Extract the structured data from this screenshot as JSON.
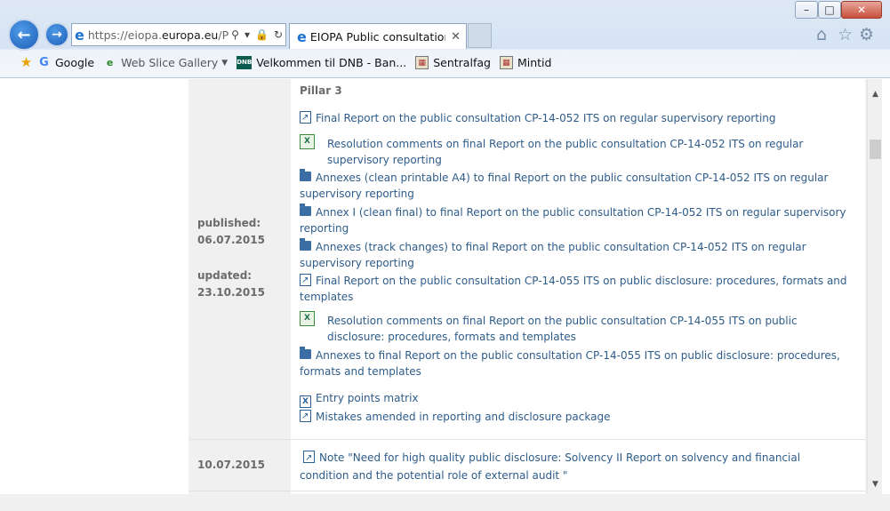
{
  "browser": {
    "address": {
      "domain_prefix": "https://eiopa.",
      "domain": "europa.eu",
      "path": "/Pag"
    },
    "tab": {
      "title": "EIOPA Public consultation ..."
    },
    "favorites": [
      {
        "label": "Google"
      },
      {
        "label": "Web Slice Gallery"
      },
      {
        "label": "Velkommen til DNB - Ban..."
      },
      {
        "label": "Sentralfag"
      },
      {
        "label": "Mintid"
      }
    ],
    "window": {
      "minimize": "–",
      "maximize": "□",
      "close": "✕"
    }
  },
  "page": {
    "section_title": "Pillar 3",
    "published_label": "published:",
    "published_date": "06.07.2015",
    "updated_label": "updated:",
    "updated_date": "23.10.2015",
    "documents": [
      {
        "type": "pdf",
        "text": "Final Report on the public consultation CP-14-052 ITS on regular supervisory reporting"
      },
      {
        "type": "xls",
        "text": "Resolution comments on final Report on the public consultation CP-14-052 ITS on regular supervisory reporting"
      },
      {
        "type": "folder",
        "text": "Annexes (clean printable A4) to final Report on the public consultation CP-14-052 ITS on regular supervisory reporting"
      },
      {
        "type": "folder",
        "text": "Annex I (clean final) to final Report on the public consultation CP-14-052 ITS on regular supervisory reporting"
      },
      {
        "type": "folder",
        "text": "Annexes (track changes) to final Report on the public consultation CP-14-052 ITS on regular supervisory reporting"
      },
      {
        "type": "pdf",
        "text": "Final Report on the public consultation CP-14-055 ITS on public disclosure: procedures, formats and templates"
      },
      {
        "type": "xls",
        "text": "Resolution comments on final Report on the public consultation CP-14-055 ITS on public disclosure: procedures, formats and templates"
      },
      {
        "type": "folder",
        "text": "Annexes to final Report on the public consultation CP-14-055 ITS on public disclosure: procedures, formats and templates"
      },
      {
        "type": "x",
        "text": "Entry points matrix"
      },
      {
        "type": "pdf",
        "text": "Mistakes amended in reporting and disclosure package"
      }
    ],
    "next_row": {
      "date": "10.07.2015",
      "document": {
        "type": "pdf",
        "text": "Note \"Need for high quality public disclosure: Solvency II Report on solvency and financial condition and the potential role of external audit \""
      }
    }
  }
}
